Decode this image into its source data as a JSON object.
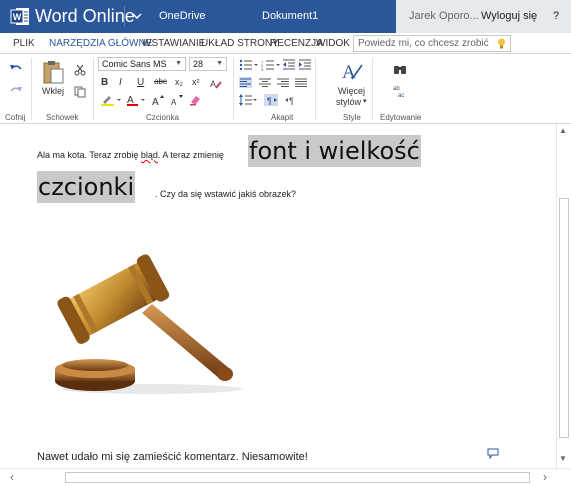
{
  "titlebar": {
    "app_name": "Word Online",
    "onedrive": "OneDrive",
    "document": "Dokument1",
    "user": "Jarek Oporo...",
    "logout": "Wyloguj się",
    "help": "?"
  },
  "tabs": [
    {
      "label": "PLIK"
    },
    {
      "label": "NARZĘDZIA GŁÓWNE"
    },
    {
      "label": "WSTAWIANIE"
    },
    {
      "label": "UKŁAD STRONY"
    },
    {
      "label": "RECENZJA"
    },
    {
      "label": "WIDOK"
    }
  ],
  "search": {
    "placeholder": "Powiedz mi, co chcesz zrobić"
  },
  "ribbon": {
    "groups": {
      "undo": "Cofnij",
      "clipboard": "Schowek",
      "font": "Czcionka",
      "paragraph": "Akapit",
      "style": "Style",
      "editing": "Edytowanie"
    },
    "paste_label": "Wklej",
    "font_name": "Comic Sans MS",
    "font_size": "28",
    "more_styles_1": "Więcej",
    "more_styles_2": "stylów",
    "bold": "B",
    "italic": "I",
    "underline": "U",
    "strike": "abc",
    "subscript": "x₂",
    "superscript": "x²"
  },
  "colors": {
    "brand": "#2b579a",
    "highlight": "#c9c9c9",
    "gavel": "#b5772a"
  },
  "document": {
    "line1_small": "Ala ma kota. Teraz zrobię ",
    "line1_error": "bląd",
    "line1_small2": ". A teraz zmienię ",
    "line1_big": "font i wielkość",
    "line2_big": "czcionki",
    "line2_small": ".  Czy da się wstawić jakiś obrazek?",
    "comment": "Nawet udało mi się zamieścić komentarz. Niesamowite!"
  }
}
